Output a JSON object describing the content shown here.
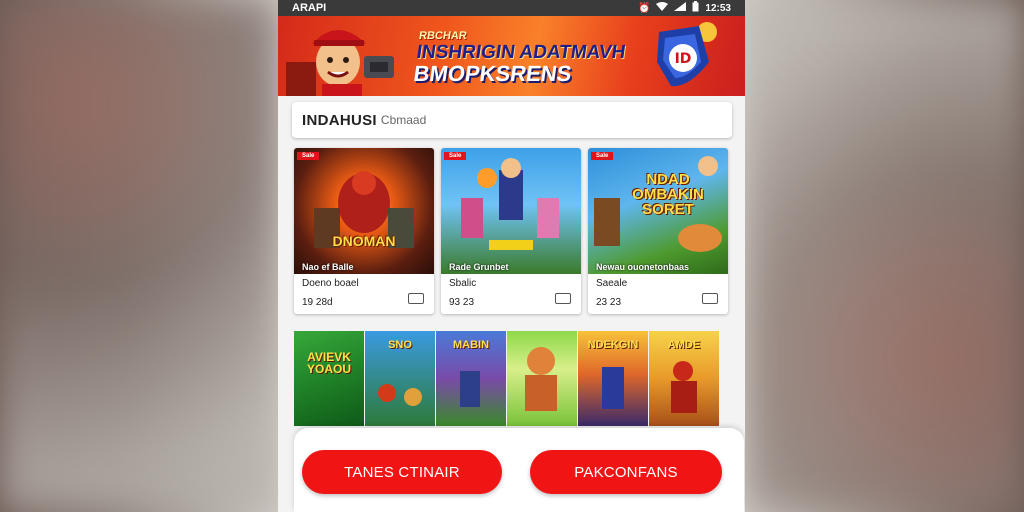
{
  "status_bar": {
    "carrier": "ARAPI",
    "time": "12:53",
    "icons": [
      "alarm-icon",
      "wifi-icon",
      "signal-icon",
      "battery-icon"
    ]
  },
  "banner": {
    "line1": "RBCHAR",
    "line2": "INSHRIGIN ADATMAVH",
    "line3": "BMOPKSRENS",
    "badge": "ID"
  },
  "search": {
    "label": "INDAHUSI",
    "hint": "Cbmaad"
  },
  "games": [
    {
      "tag": "Sale",
      "art_title": "DNOMAN",
      "caption": "Nao ef Balle",
      "name": "Doeno boael",
      "price": "19 28d"
    },
    {
      "tag": "Sale",
      "art_title": "",
      "caption": "Rade Grunbet",
      "name": "Sbalic",
      "price": "93 23"
    },
    {
      "tag": "Sale",
      "art_title": "NDAD OMBAKIN SORET",
      "caption": "Newau ouonetonbaas",
      "name": "Saeale",
      "price": "23 23"
    }
  ],
  "tiles": [
    {
      "title": "AVIEVK YOAOU"
    },
    {
      "title": "SNO"
    },
    {
      "title": "MABIN"
    },
    {
      "title": ""
    },
    {
      "title": "NDEKGIN"
    },
    {
      "title": "AMDE"
    }
  ],
  "buttons": {
    "left": "TANES CTINAIR",
    "right": "PAKCONFANS"
  },
  "colors": {
    "accent": "#f01414",
    "banner_start": "#d42a1a",
    "banner_end": "#c91e1e"
  }
}
